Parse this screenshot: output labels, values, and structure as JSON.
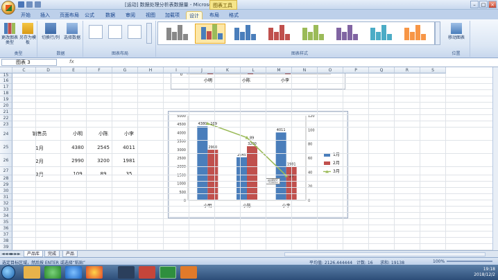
{
  "window": {
    "title": "[运动] 数据处理分析表数据量 - Microsoft Ex...",
    "context_tool": "图表工具"
  },
  "tabs": [
    "开始",
    "插入",
    "页面布局",
    "公式",
    "数据",
    "审阅",
    "视图",
    "加载项",
    "设计",
    "布局",
    "格式"
  ],
  "ribbon": {
    "type_group": {
      "label": "类型",
      "buttons": [
        "更改图表类型",
        "另存为模板"
      ]
    },
    "data_group": {
      "label": "数据",
      "buttons": [
        "切换行/列",
        "选择数据"
      ]
    },
    "layout_group": {
      "label": "图表布局"
    },
    "styles_group": {
      "label": "图表样式"
    },
    "location_group": {
      "label": "位置",
      "buttons": [
        "移动图表"
      ]
    }
  },
  "formula_bar": {
    "name_box": "图表 3",
    "fx": "fx"
  },
  "columns": [
    "C",
    "D",
    "E",
    "F",
    "G",
    "H",
    "I",
    "J",
    "K",
    "L",
    "M",
    "N",
    "O",
    "P",
    "Q",
    "R",
    "S"
  ],
  "rows": [
    "15",
    "16",
    "17",
    "18",
    "19",
    "20",
    "21",
    "22",
    "23",
    "24",
    "25",
    "26",
    "27",
    "28",
    "29",
    "30",
    "31",
    "32",
    "33",
    "34",
    "35",
    "36",
    "37",
    "38",
    "39",
    "40",
    "41"
  ],
  "table": {
    "header": [
      "销售员",
      "小明",
      "小陈",
      "小李"
    ],
    "rows": [
      [
        "1月",
        "4380",
        "2545",
        "4011"
      ],
      [
        "2月",
        "2990",
        "3200",
        "1981"
      ],
      [
        "3月",
        "109",
        "89",
        "35"
      ]
    ]
  },
  "top_chart": {
    "categories": [
      "小明",
      "小陈",
      "小李"
    ],
    "baseline_label": "0"
  },
  "chart_data": {
    "type": "bar",
    "categories": [
      "小明",
      "小陈",
      "小李"
    ],
    "series": [
      {
        "name": "1月",
        "values": [
          4380,
          2545,
          4011
        ],
        "color": "#4a7ebb",
        "kind": "bar",
        "axis": "primary"
      },
      {
        "name": "2月",
        "values": [
          2990,
          3200,
          1981
        ],
        "color": "#c0504d",
        "kind": "bar",
        "axis": "primary"
      },
      {
        "name": "3月",
        "values": [
          109,
          89,
          35
        ],
        "color": "#9bbb59",
        "kind": "line",
        "axis": "secondary"
      }
    ],
    "data_labels": [
      "4380",
      "109",
      "2990",
      "2545",
      "89",
      "3200",
      "4011",
      "1981",
      "35"
    ],
    "y_primary": {
      "min": 0,
      "max": 5000,
      "ticks": [
        "0",
        "500",
        "1000",
        "1500",
        "2000",
        "2500",
        "3000",
        "3500",
        "4000",
        "4500",
        "5000"
      ]
    },
    "y_secondary": {
      "min": 0,
      "max": 120,
      "ticks": [
        "0",
        "20",
        "40",
        "60",
        "80",
        "100",
        "120"
      ]
    },
    "legend_position": "right",
    "tooltip": "绘图区",
    "grid": false
  },
  "sheet_tabs": [
    "产品库",
    "完成",
    "产品"
  ],
  "status": {
    "left": "选定目标区域，然后按 ENTER 或选择“粘贴”",
    "average": "平均值: 2126.444444",
    "count": "计数: 16",
    "sum": "求和: 19138",
    "zoom": "100%"
  },
  "taskbar": {
    "time": "19:18",
    "date": "2018/12/2"
  },
  "colors": {
    "accent": "#4a7ebb",
    "red": "#c0504d",
    "green": "#9bbb59"
  }
}
